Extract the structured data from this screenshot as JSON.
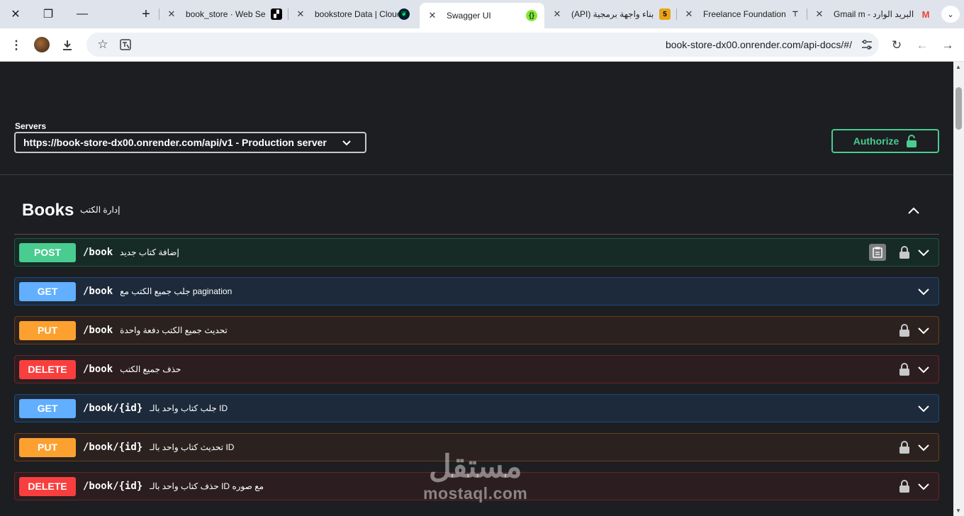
{
  "browser": {
    "tabs": [
      {
        "title": "book_store · Web Se",
        "favicon": "render-icon"
      },
      {
        "title": "bookstore Data | Cloud",
        "favicon": "mongodb-leaf-icon"
      },
      {
        "title": "Swagger UI",
        "favicon": "swagger-icon",
        "active": true
      },
      {
        "title": "بناء واجهة برمجية (API)",
        "favicon": "mostaql-5-icon"
      },
      {
        "title": "Freelance Foundation",
        "favicon": "hootsuite-icon"
      },
      {
        "title": "البريد الوارد - Gmail m",
        "favicon": "gmail-icon"
      }
    ],
    "new_tab_label": "+",
    "url": "book-store-dx00.onrender.com/api-docs/#/"
  },
  "servers": {
    "label": "Servers",
    "selected": "https://book-store-dx00.onrender.com/api/v1 - Production server"
  },
  "authorize": {
    "label": "Authorize"
  },
  "tag": {
    "name": "Books",
    "description": "إدارة الكتب"
  },
  "operations": [
    {
      "method": "POST",
      "path": "/book",
      "summary": "إضافة كتاب جديد",
      "locked": true,
      "copy": true
    },
    {
      "method": "GET",
      "path": "/book",
      "summary": "جلب جميع الكتب مع pagination",
      "locked": false
    },
    {
      "method": "PUT",
      "path": "/book",
      "summary": "تحديث جميع الكتب دفعة واحدة",
      "locked": true
    },
    {
      "method": "DELETE",
      "path": "/book",
      "summary": "حذف جميع الكتب",
      "locked": true
    },
    {
      "method": "GET",
      "path": "/book/{id}",
      "summary": "جلب كتاب واحد بالـ ID",
      "locked": false
    },
    {
      "method": "PUT",
      "path": "/book/{id}",
      "summary": "تحديث كتاب واحد بالـ ID",
      "locked": true
    },
    {
      "method": "DELETE",
      "path": "/book/{id}",
      "summary": "حذف كتاب واحد بالـ ID مع صوره",
      "locked": true
    }
  ],
  "watermark": {
    "arabic": "مستقل",
    "latin": "mostaql.com"
  },
  "colors": {
    "post": "#49cc90",
    "get": "#61affe",
    "put": "#fca130",
    "delete": "#f93e3e",
    "page_bg": "#1c1e21"
  }
}
